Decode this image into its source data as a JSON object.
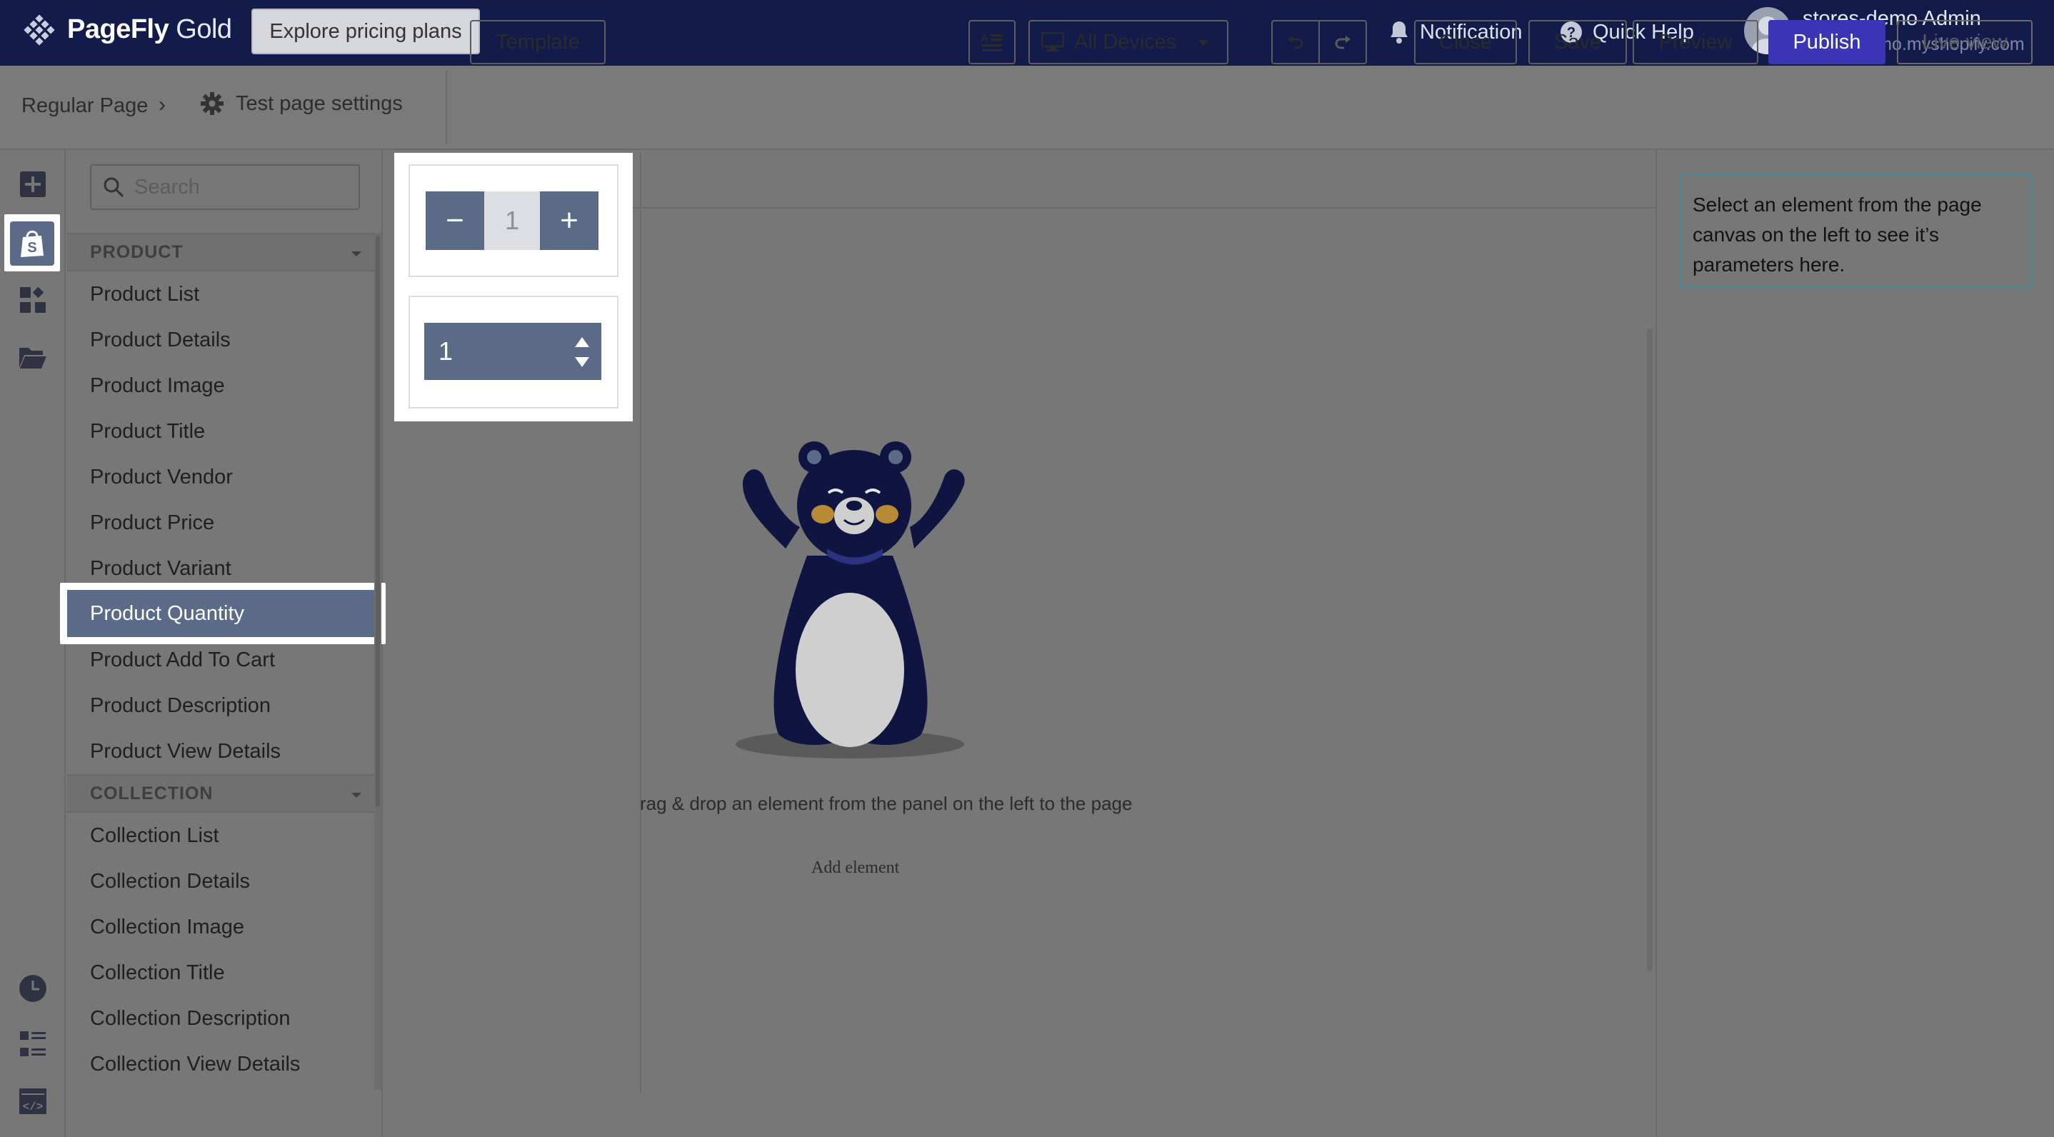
{
  "app": {
    "brand": "PageFly",
    "plan": "Gold",
    "explore_label": "Explore pricing plans"
  },
  "header": {
    "notification_label": "Notification",
    "help_label": "Quick Help",
    "user_name": "stores-demo Admin",
    "user_store": "stores-demo.myshopify.com"
  },
  "toolbar": {
    "breadcrumb": "Regular Page",
    "settings_label": "Test page settings",
    "template_label": "Template",
    "devices_label": "All Devices",
    "close_label": "Close",
    "save_label": "Save",
    "preview_label": "Preview",
    "publish_label": "Publish",
    "live_label": "Live view"
  },
  "panel": {
    "search_placeholder": "Search",
    "product_section": "PRODUCT",
    "product_items": [
      "Product List",
      "Product Details",
      "Product Image",
      "Product Title",
      "Product Vendor",
      "Product Price",
      "Product Variant",
      "Product Quantity",
      "Product Add To Cart",
      "Product Description",
      "Product View Details"
    ],
    "active_item": "Product Quantity",
    "collection_section": "COLLECTION",
    "collection_items": [
      "Collection List",
      "Collection Details",
      "Collection Image",
      "Collection Title",
      "Collection Description",
      "Collection View Details"
    ]
  },
  "quantity_preview": {
    "style1": {
      "minus": "−",
      "value": "1",
      "plus": "+"
    },
    "style2": {
      "value": "1"
    }
  },
  "canvas": {
    "hint": "rag & drop an element from the panel on the left to the page",
    "add_element": "Add element"
  },
  "inspector": {
    "message": "Select an element from the page canvas on the left to see it’s parameters here."
  },
  "colors": {
    "topbar": "#121b4a",
    "publish": "#3b34b4",
    "accent_slate": "#5b6a87",
    "info_border": "#3f8b9a"
  },
  "icons": {
    "rail": [
      "add-icon",
      "shopify-bag-icon",
      "widgets-icon",
      "folder-icon",
      "history-icon",
      "list-icon",
      "code-icon"
    ]
  }
}
